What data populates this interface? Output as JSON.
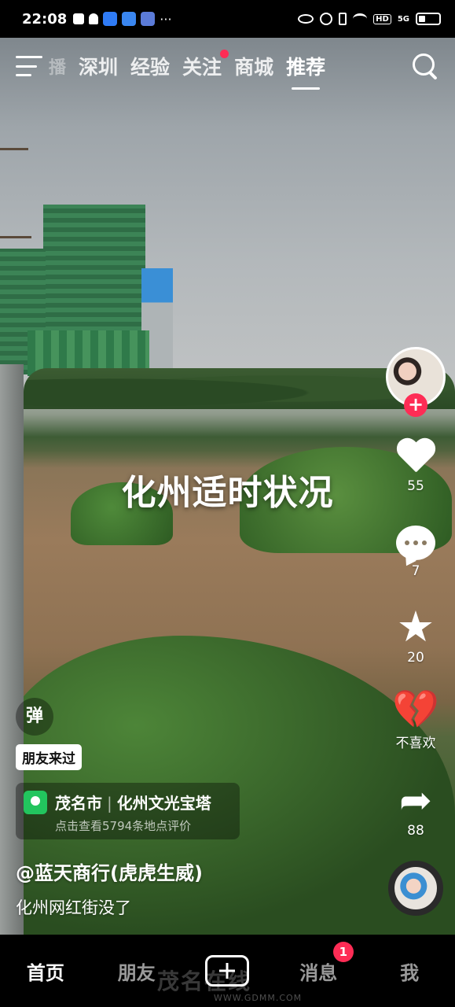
{
  "status_bar": {
    "time": "22:08",
    "right_text": "HD",
    "signal_label": "5G"
  },
  "top_nav": {
    "partial_tab": "播",
    "tabs": [
      {
        "label": "深圳"
      },
      {
        "label": "经验"
      },
      {
        "label": "关注"
      },
      {
        "label": "商城"
      },
      {
        "label": "推荐"
      }
    ],
    "active_tab": "推荐"
  },
  "video": {
    "caption": "化州适时状况"
  },
  "sidebar": {
    "like_count": "55",
    "comment_count": "7",
    "favorite_count": "20",
    "dislike_label": "不喜欢",
    "share_count": "88",
    "follow_symbol": "+"
  },
  "info": {
    "danmu_label": "弹",
    "friend_tag": "朋友来过",
    "location_city": "茂名市",
    "location_place": "化州文光宝塔",
    "location_sub": "点击查看5794条地点评价",
    "author": "@蓝天商行(虎虎生威)",
    "description": "化州网红街没了"
  },
  "bottom_nav": {
    "home": "首页",
    "friends": "朋友",
    "messages": "消息",
    "messages_badge": "1",
    "me": "我"
  },
  "watermark": {
    "text": "茂名在线",
    "url": "WWW.GDMM.COM"
  },
  "colors": {
    "accent_red": "#fe2c55",
    "location_green": "#22c55e"
  }
}
